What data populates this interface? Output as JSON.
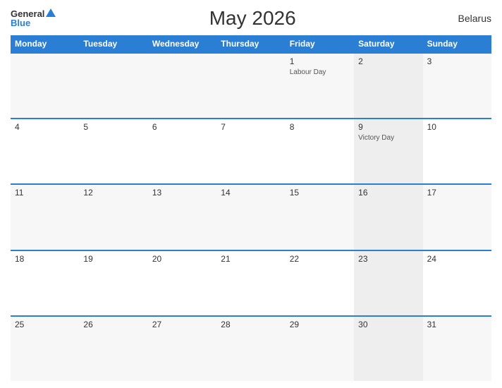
{
  "header": {
    "logo_general": "General",
    "logo_blue": "Blue",
    "title": "May 2026",
    "country": "Belarus"
  },
  "calendar": {
    "days_of_week": [
      "Monday",
      "Tuesday",
      "Wednesday",
      "Thursday",
      "Friday",
      "Saturday",
      "Sunday"
    ],
    "weeks": [
      [
        {
          "day": "",
          "holiday": ""
        },
        {
          "day": "",
          "holiday": ""
        },
        {
          "day": "",
          "holiday": ""
        },
        {
          "day": "",
          "holiday": ""
        },
        {
          "day": "1",
          "holiday": "Labour Day"
        },
        {
          "day": "2",
          "holiday": ""
        },
        {
          "day": "3",
          "holiday": ""
        }
      ],
      [
        {
          "day": "4",
          "holiday": ""
        },
        {
          "day": "5",
          "holiday": ""
        },
        {
          "day": "6",
          "holiday": ""
        },
        {
          "day": "7",
          "holiday": ""
        },
        {
          "day": "8",
          "holiday": ""
        },
        {
          "day": "9",
          "holiday": "Victory Day"
        },
        {
          "day": "10",
          "holiday": ""
        }
      ],
      [
        {
          "day": "11",
          "holiday": ""
        },
        {
          "day": "12",
          "holiday": ""
        },
        {
          "day": "13",
          "holiday": ""
        },
        {
          "day": "14",
          "holiday": ""
        },
        {
          "day": "15",
          "holiday": ""
        },
        {
          "day": "16",
          "holiday": ""
        },
        {
          "day": "17",
          "holiday": ""
        }
      ],
      [
        {
          "day": "18",
          "holiday": ""
        },
        {
          "day": "19",
          "holiday": ""
        },
        {
          "day": "20",
          "holiday": ""
        },
        {
          "day": "21",
          "holiday": ""
        },
        {
          "day": "22",
          "holiday": ""
        },
        {
          "day": "23",
          "holiday": ""
        },
        {
          "day": "24",
          "holiday": ""
        }
      ],
      [
        {
          "day": "25",
          "holiday": ""
        },
        {
          "day": "26",
          "holiday": ""
        },
        {
          "day": "27",
          "holiday": ""
        },
        {
          "day": "28",
          "holiday": ""
        },
        {
          "day": "29",
          "holiday": ""
        },
        {
          "day": "30",
          "holiday": ""
        },
        {
          "day": "31",
          "holiday": ""
        }
      ]
    ]
  }
}
